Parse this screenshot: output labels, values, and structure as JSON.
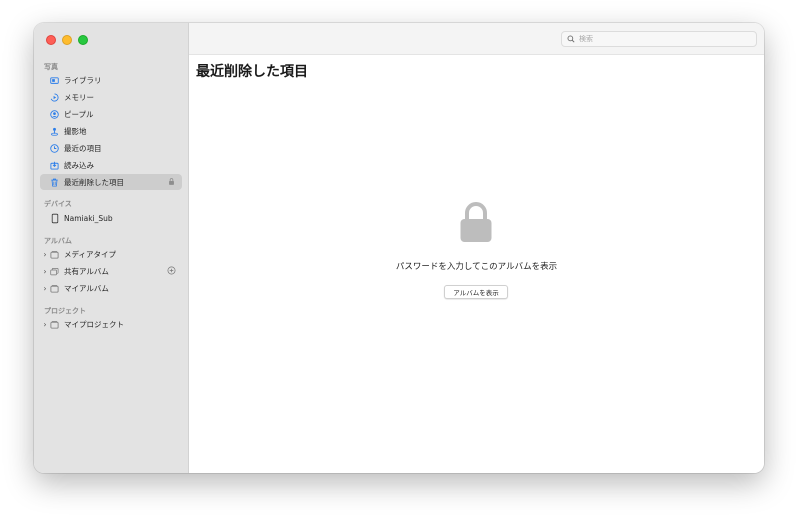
{
  "window": {
    "title": "最近削除した項目"
  },
  "sidebar": {
    "section_photos": "写真",
    "photos_items": [
      {
        "label": "ライブラリ",
        "icon": "library-icon"
      },
      {
        "label": "メモリー",
        "icon": "memories-icon"
      },
      {
        "label": "ピープル",
        "icon": "people-icon"
      },
      {
        "label": "撮影地",
        "icon": "places-icon"
      },
      {
        "label": "最近の項目",
        "icon": "recents-icon"
      },
      {
        "label": "読み込み",
        "icon": "imports-icon"
      },
      {
        "label": "最近削除した項目",
        "icon": "trash-icon",
        "selected": true,
        "trailing_icon": "lock-icon"
      }
    ],
    "section_devices": "デバイス",
    "device_items": [
      {
        "label": "Namiaki_Sub",
        "icon": "phone-icon"
      }
    ],
    "section_albums": "アルバム",
    "album_items": [
      {
        "label": "メディアタイプ",
        "icon": "folder-icon"
      },
      {
        "label": "共有アルバム",
        "icon": "shared-album-icon",
        "trailing_icon": "add-circle-icon"
      },
      {
        "label": "マイアルバム",
        "icon": "folder-icon"
      }
    ],
    "section_projects": "プロジェクト",
    "project_items": [
      {
        "label": "マイプロジェクト",
        "icon": "folder-icon"
      }
    ]
  },
  "toolbar": {
    "search_placeholder": "検索"
  },
  "main": {
    "title": "最近削除した項目",
    "message": "パスワードを入力してこのアルバムを表示",
    "button_label": "アルバムを表示"
  },
  "colors": {
    "accent": "#2b7de9",
    "lock_gray": "#bdbdbd",
    "sidebar_bg": "#e3e3e3",
    "selected_bg": "#cdcdcd"
  }
}
